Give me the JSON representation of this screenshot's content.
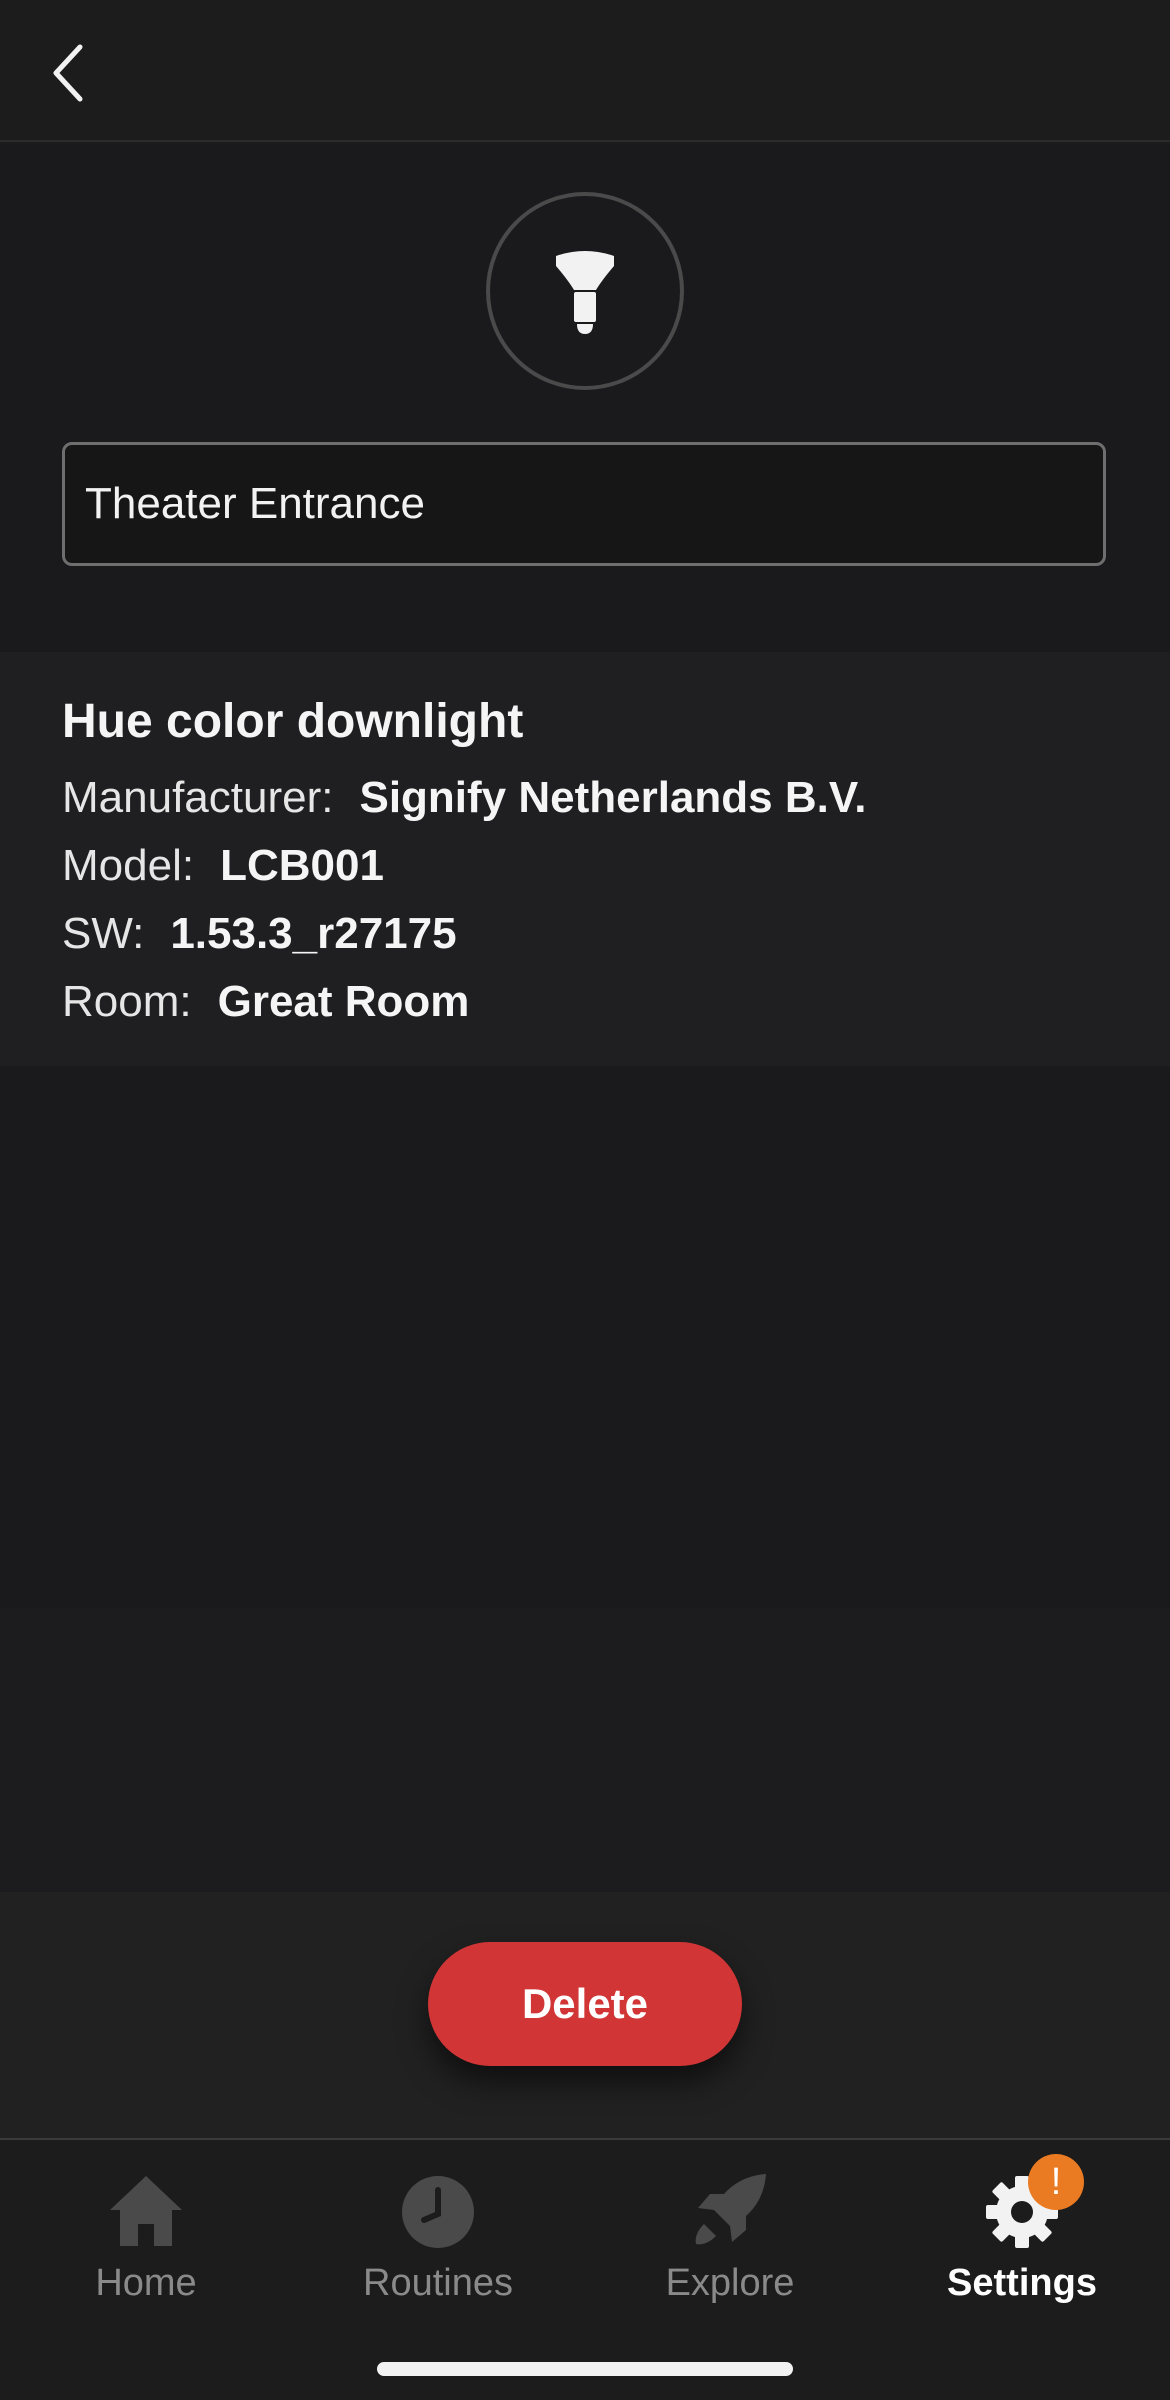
{
  "header": {
    "back_icon": "chevron-left-icon"
  },
  "light": {
    "icon": "downlight-icon",
    "name_value": "Theater Entrance",
    "name_placeholder": ""
  },
  "details": {
    "product": "Hue color downlight",
    "rows": [
      {
        "label": "Manufacturer:",
        "value": "Signify Netherlands B.V."
      },
      {
        "label": "Model:",
        "value": "LCB001"
      },
      {
        "label": "SW:",
        "value": "1.53.3_r27175"
      },
      {
        "label": "Room:",
        "value": "Great Room"
      }
    ]
  },
  "actions": {
    "delete_label": "Delete",
    "delete_color": "#d13535"
  },
  "tabs": [
    {
      "label": "Home",
      "icon": "home-icon",
      "active": false
    },
    {
      "label": "Routines",
      "icon": "clock-icon",
      "active": false
    },
    {
      "label": "Explore",
      "icon": "rocket-icon",
      "active": false
    },
    {
      "label": "Settings",
      "icon": "gear-icon",
      "active": true,
      "badge": "!"
    }
  ],
  "colors": {
    "accent": "#ea7b22",
    "background": "#1c1c1e"
  }
}
